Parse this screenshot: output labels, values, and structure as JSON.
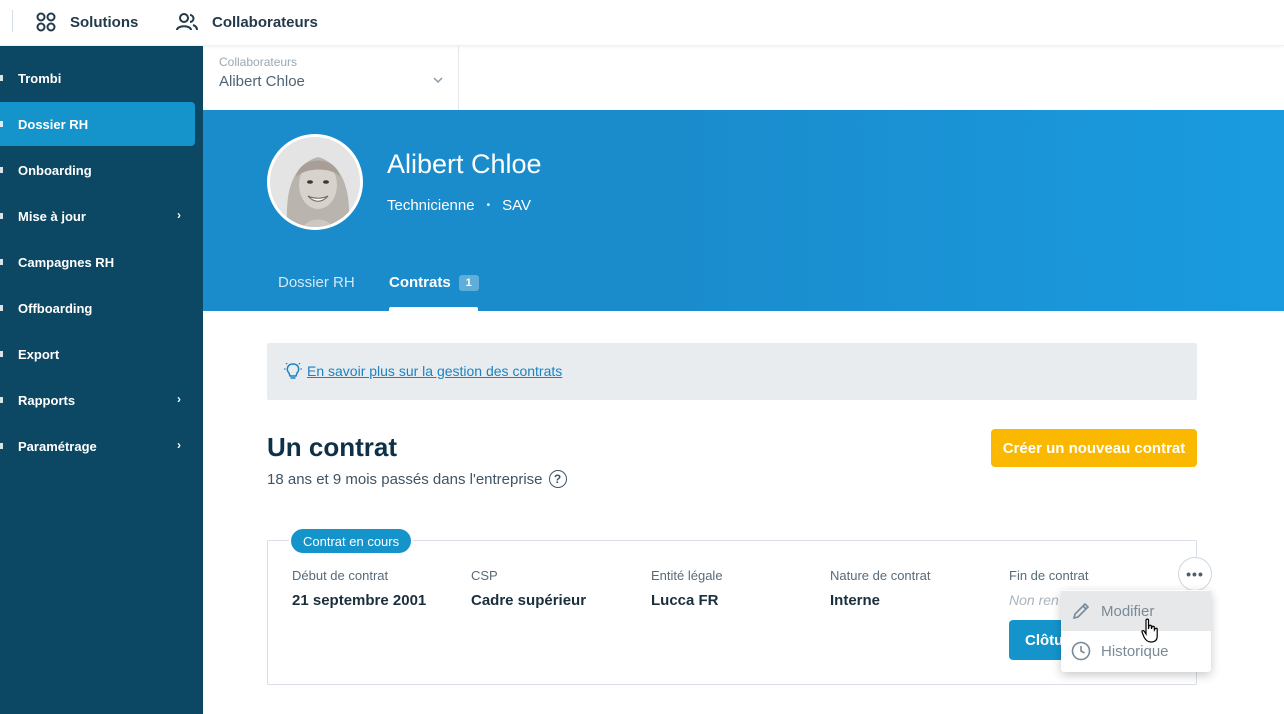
{
  "topbar": {
    "solutions_label": "Solutions",
    "collaborateurs_label": "Collaborateurs"
  },
  "sidebar": {
    "items": [
      {
        "label": "Trombi",
        "has_submenu": false,
        "active": false
      },
      {
        "label": "Dossier RH",
        "has_submenu": false,
        "active": true
      },
      {
        "label": "Onboarding",
        "has_submenu": false,
        "active": false
      },
      {
        "label": "Mise à jour",
        "has_submenu": true,
        "active": false
      },
      {
        "label": "Campagnes RH",
        "has_submenu": false,
        "active": false
      },
      {
        "label": "Offboarding",
        "has_submenu": false,
        "active": false
      },
      {
        "label": "Export",
        "has_submenu": false,
        "active": false
      },
      {
        "label": "Rapports",
        "has_submenu": true,
        "active": false
      },
      {
        "label": "Paramétrage",
        "has_submenu": true,
        "active": false
      }
    ]
  },
  "selector": {
    "label": "Collaborateurs",
    "value": "Alibert Chloe"
  },
  "profile": {
    "name": "Alibert Chloe",
    "job_title": "Technicienne",
    "department": "SAV"
  },
  "tabs": [
    {
      "label": "Dossier RH",
      "active": false
    },
    {
      "label": "Contrats",
      "active": true,
      "badge": "1"
    }
  ],
  "info": {
    "link_text": "En savoir plus sur la gestion des contrats"
  },
  "contracts": {
    "heading": "Un contrat",
    "tenure": "18 ans et 9 mois passés dans l'entreprise",
    "create_button": "Créer un nouveau contrat",
    "current": {
      "status_pill": "Contrat en cours",
      "fields": [
        {
          "label": "Début de contrat",
          "value": "21 septembre 2001"
        },
        {
          "label": "CSP",
          "value": "Cadre supérieur"
        },
        {
          "label": "Entité légale",
          "value": "Lucca FR"
        },
        {
          "label": "Nature de contrat",
          "value": "Interne"
        },
        {
          "label": "Fin de contrat",
          "value": "Non ren"
        }
      ],
      "close_button": "Clôtu",
      "more_button": "•••"
    }
  },
  "menu": {
    "items": [
      {
        "label": "Modifier",
        "icon": "pencil-icon",
        "hovered": true
      },
      {
        "label": "Historique",
        "icon": "clock-icon",
        "hovered": false
      }
    ]
  },
  "colors": {
    "sidebar_bg": "#0c4763",
    "accent_blue": "#1594cc",
    "create_button": "#fbb800"
  }
}
